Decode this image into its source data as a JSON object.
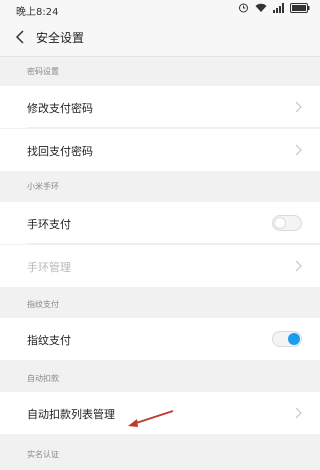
{
  "status": {
    "time": "晚上8:24",
    "icons": [
      "alarm-icon",
      "wifi-icon",
      "signal-icon",
      "battery-icon"
    ]
  },
  "titlebar": {
    "title": "安全设置"
  },
  "sections": {
    "password": {
      "header": "密码设置",
      "items": [
        "修改支付密码",
        "找回支付密码"
      ]
    },
    "band": {
      "header": "小米手环",
      "items": [
        {
          "label": "手环支付",
          "toggle": false
        },
        {
          "label": "手环管理",
          "disabled": true
        }
      ]
    },
    "fingerprint": {
      "header": "指纹支付",
      "items": [
        {
          "label": "指纹支付",
          "toggle": true
        }
      ]
    },
    "autodebit": {
      "header": "自动扣款",
      "items": [
        "自动扣款列表管理"
      ]
    },
    "realname": {
      "header": "实名认证"
    }
  },
  "colors": {
    "toggle_on": "#1c9cf0",
    "annotation_arrow": "#c0392b"
  }
}
